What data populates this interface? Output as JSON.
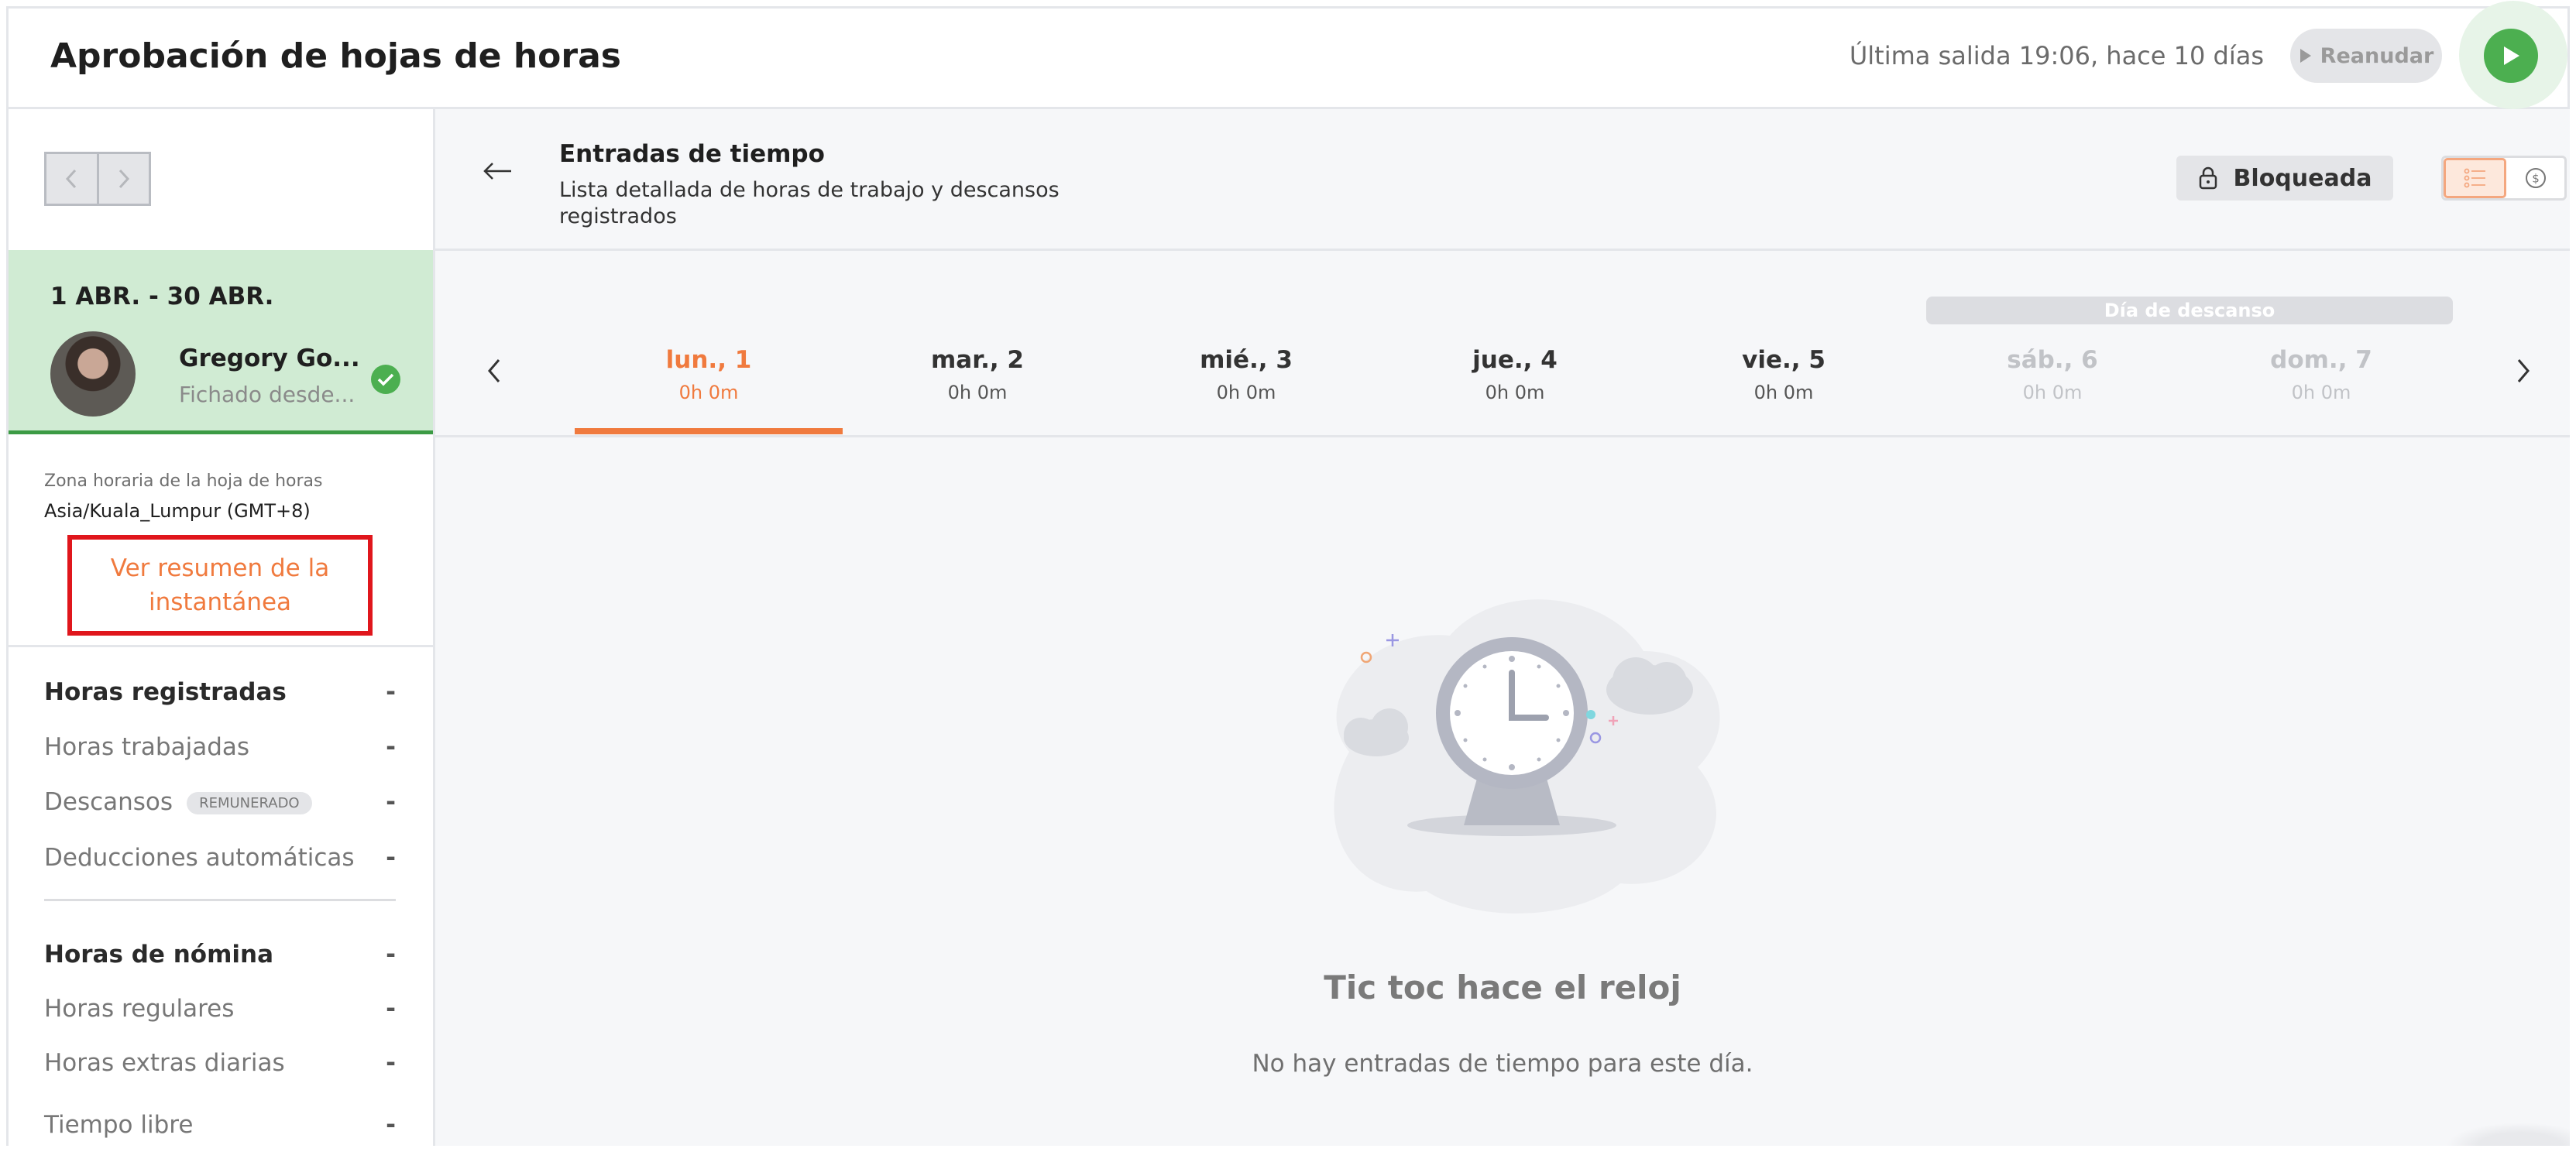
{
  "header": {
    "title": "Aprobación de hojas de horas",
    "last_exit": "Última salida 19:06, hace 10 días",
    "resume_label": "Reanudar",
    "colors": {
      "start_button": "#4caf50",
      "resume_bg": "#e4e5e8"
    }
  },
  "sidebar": {
    "nav_prev_icon": "chevron-left-icon",
    "nav_next_icon": "chevron-right-icon",
    "period": "1 ABR. - 30 ABR.",
    "employee": {
      "name": "Gregory Go...",
      "status": "Fichado desde..."
    },
    "timezone_label": "Zona horaria de la hoja de horas",
    "timezone_value": "Asia/Kuala_Lumpur (GMT+8)",
    "snapshot_link": "Ver resumen de la instantánea",
    "stats": [
      {
        "label": "Horas registradas",
        "value": "-",
        "bold": true
      },
      {
        "label": "Horas trabajadas",
        "value": "-"
      },
      {
        "label": "Descansos",
        "value": "-",
        "badge": "REMUNERADO"
      },
      {
        "label": "Deducciones automáticas",
        "value": "-"
      },
      {
        "label": "Horas de nómina",
        "value": "-",
        "bold": true
      },
      {
        "label": "Horas regulares",
        "value": "-"
      },
      {
        "label": "Horas extras diarias",
        "value": "-"
      },
      {
        "label": "Tiempo libre",
        "value": "-"
      }
    ],
    "colors": {
      "period_bg": "#d0ebd3",
      "period_border": "#3c9b45",
      "link": "#f07a3e",
      "highlight": "#e0161c"
    }
  },
  "main": {
    "section_title": "Entradas de tiempo",
    "section_desc": "Lista detallada de horas de trabajo y descansos registrados",
    "locked_label": "Bloqueada",
    "rest_day_label": "Día de descanso",
    "days": [
      {
        "label": "lun., 1",
        "hours": "0h 0m"
      },
      {
        "label": "mar., 2",
        "hours": "0h 0m"
      },
      {
        "label": "mié., 3",
        "hours": "0h 0m"
      },
      {
        "label": "jue., 4",
        "hours": "0h 0m"
      },
      {
        "label": "vie., 5",
        "hours": "0h 0m"
      },
      {
        "label": "sáb., 6",
        "hours": "0h 0m"
      },
      {
        "label": "dom., 7",
        "hours": "0h 0m"
      }
    ],
    "empty_title": "Tic toc hace el reloj",
    "empty_sub": "No hay entradas de tiempo para este día.",
    "colors": {
      "accent": "#f07a3e",
      "muted": "#c1c3c7"
    }
  }
}
